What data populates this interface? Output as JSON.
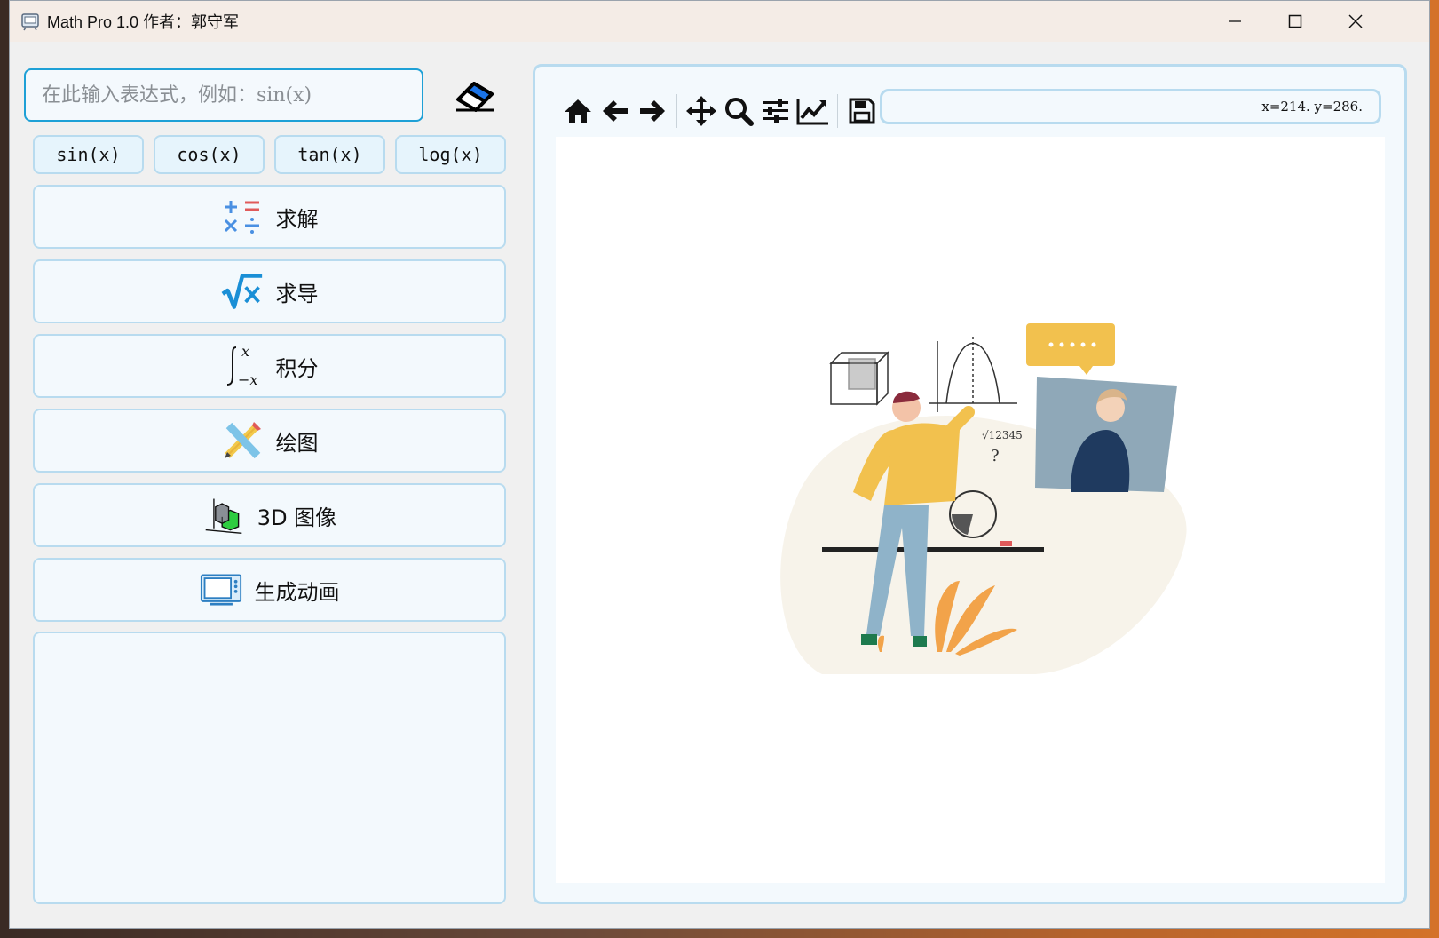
{
  "window": {
    "title": "Math Pro 1.0 作者：郭守军"
  },
  "input": {
    "placeholder": "在此输入表达式，例如：sin(x)",
    "value": ""
  },
  "function_buttons": [
    "sin(x)",
    "cos(x)",
    "tan(x)",
    "log(x)"
  ],
  "action_buttons": [
    {
      "label": "求解",
      "icon": "arithmetic-icon"
    },
    {
      "label": "求导",
      "icon": "sqrt-icon"
    },
    {
      "label": "积分",
      "icon": "integral-icon"
    },
    {
      "label": "绘图",
      "icon": "pencil-ruler-icon"
    },
    {
      "label": "3D 图像",
      "icon": "3d-cube-icon"
    },
    {
      "label": "生成动画",
      "icon": "monitor-icon"
    }
  ],
  "toolbar": {
    "icons": [
      "home-icon",
      "back-icon",
      "forward-icon",
      "pan-icon",
      "zoom-icon",
      "subplots-icon",
      "edit-curve-icon",
      "save-icon"
    ]
  },
  "coords": {
    "text": "x=214.  y=286."
  },
  "colors": {
    "accent": "#1ea0d6",
    "panel_border": "#b8dbef",
    "panel_bg": "#f3f9fd"
  }
}
